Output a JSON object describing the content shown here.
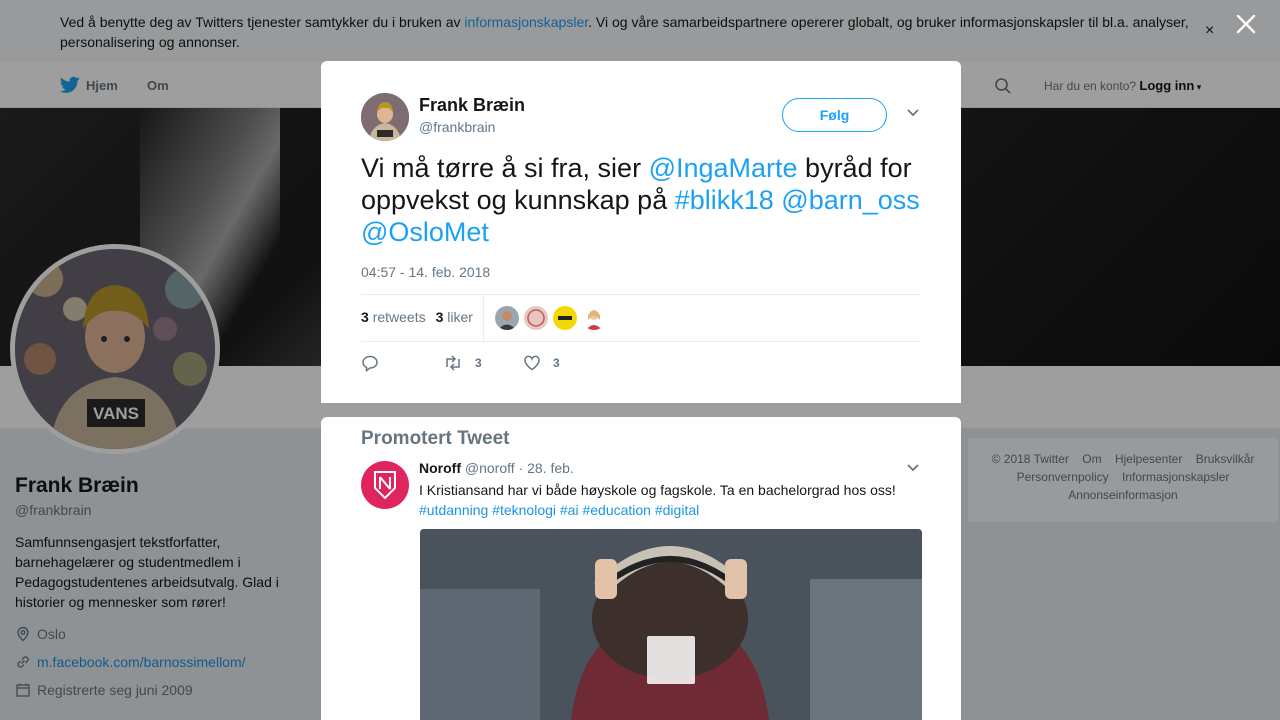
{
  "cookie": {
    "text_before": "Ved å benytte deg av Twitters tjenester samtykker du i bruken av ",
    "link": "informasjonskapsler",
    "text_after": ". Vi og våre samarbeidspartnere opererer globalt, og bruker informasjonskapsler til bl.a. analyser, personalisering og annonser.",
    "close": "×"
  },
  "nav": {
    "home": "Hjem",
    "about": "Om",
    "account_question": "Har du en konto?",
    "login": "Logg inn"
  },
  "profile": {
    "name": "Frank Bræin",
    "handle": "@frankbrain",
    "bio": "Samfunnsengasjert tekstforfatter, barnehagelærer og studentmedlem i Pedagogstudentenes arbeidsutvalg. Glad i historier og mennesker som rører!",
    "location": "Oslo",
    "url": "m.facebook.com/barnossimellom/",
    "joined": "Registrerte seg juni 2009"
  },
  "footer": {
    "links": [
      "© 2018 Twitter",
      "Om",
      "Hjelpesenter",
      "Bruksvilkår",
      "Personvernpolicy",
      "Informasjonskapsler",
      "Annonseinformasjon"
    ]
  },
  "tweet": {
    "name": "Frank Bræin",
    "handle": "@frankbrain",
    "follow": "Følg",
    "text_parts": [
      {
        "t": "Vi må tørre å si fra, sier ",
        "link": false
      },
      {
        "t": "@IngaMarte",
        "link": true
      },
      {
        "t": " byråd for oppvekst og kunnskap på ",
        "link": false
      },
      {
        "t": "#blikk18",
        "link": true
      },
      {
        "t": " ",
        "link": false
      },
      {
        "t": "@barn_oss",
        "link": true
      },
      {
        "t": " ",
        "link": false
      },
      {
        "t": "@OsloMet",
        "link": true
      }
    ],
    "timestamp": "04:57 - 14. feb. 2018",
    "retweets_count": "3",
    "retweets_label": "retweets",
    "likes_count": "3",
    "likes_label": "liker",
    "action_retweets": "3",
    "action_likes": "3"
  },
  "promoted": {
    "title": "Promotert Tweet",
    "name": "Noroff",
    "handle": "@noroff",
    "date": "· 28. feb.",
    "text": "I Kristiansand har vi både høyskole og fagskole. Ta en bachelorgrad hos oss!",
    "tags": "#utdanning #teknologi #ai #education #digital"
  },
  "colors": {
    "accent": "#1da1f2",
    "promo_avatar": "#e0245e",
    "liker_yellow": "#f5d800"
  },
  "icons": [
    "twitter-bird-icon",
    "search-icon",
    "close-icon",
    "chevron-down-icon",
    "reply-icon",
    "retweet-icon",
    "heart-icon",
    "location-icon",
    "link-icon",
    "calendar-icon",
    "play-icon"
  ]
}
